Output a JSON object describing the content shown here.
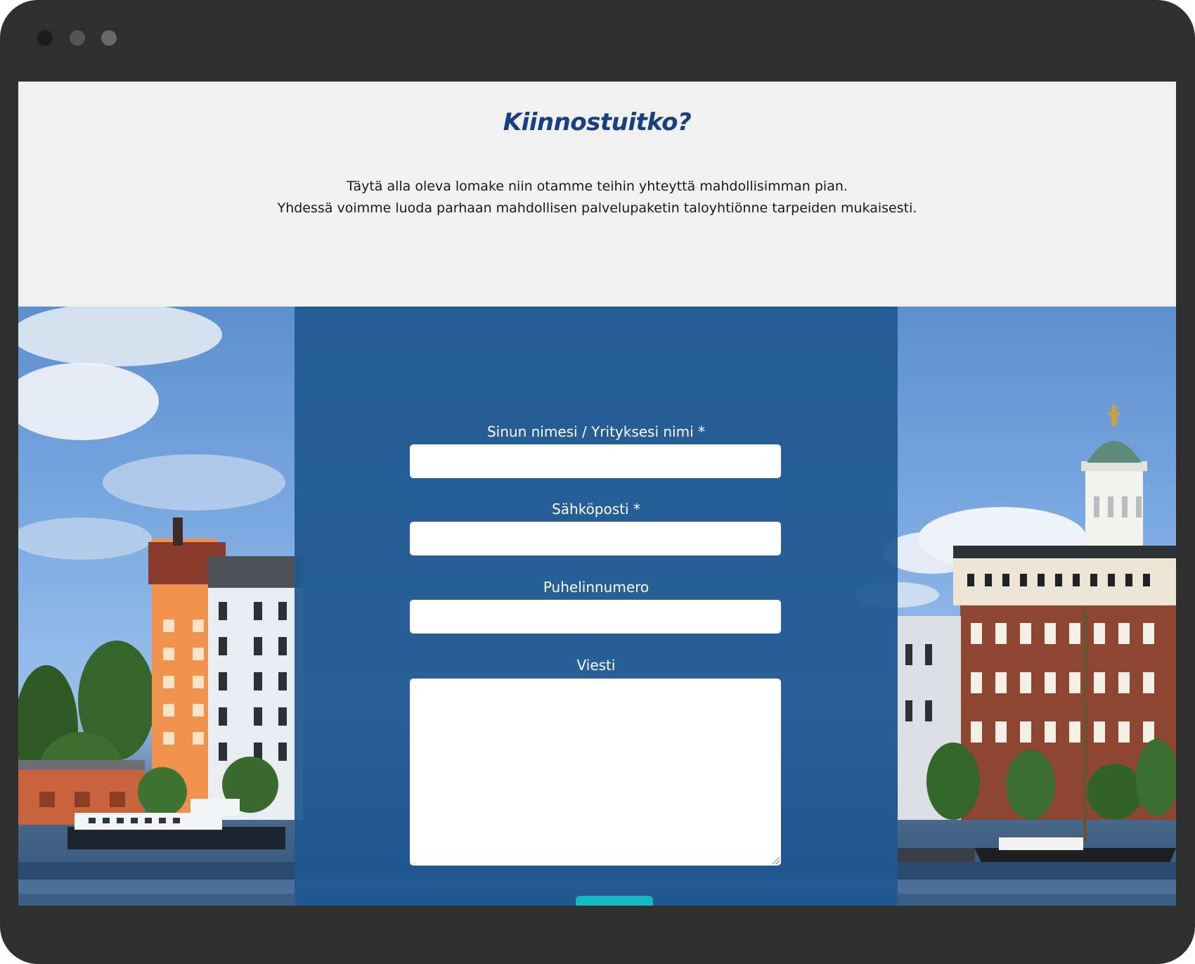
{
  "window": {
    "controls": [
      "close-dot",
      "minimize-dot",
      "zoom-dot"
    ]
  },
  "header": {
    "title": "Kiinnostuitko?",
    "intro_line_1": "Täytä alla oleva lomake niin otamme teihin yhteyttä mahdollisimman pian.",
    "intro_line_2": "Yhdessä voimme luoda parhaan mahdollisen palvelupaketin taloyhtiönne tarpeiden mukaisesti."
  },
  "form": {
    "name_label": "Sinun nimesi / Yrityksesi nimi *",
    "name_value": "",
    "email_label": "Sähköposti *",
    "email_value": "",
    "phone_label": "Puhelinnumero",
    "phone_value": "",
    "message_label": "Viesti",
    "message_value": "",
    "submit_label": ""
  },
  "colors": {
    "heading": "#173f82",
    "panel": "#205891",
    "submit": "#12b8c4",
    "frame": "#2f2f2f"
  }
}
